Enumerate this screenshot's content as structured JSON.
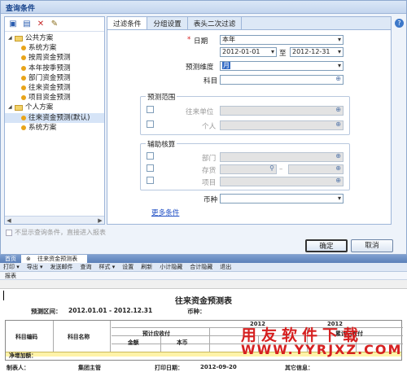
{
  "dialog": {
    "title": "查询条件"
  },
  "left_toolbar": {
    "icons": [
      "save-icon",
      "save-as-icon",
      "delete-icon",
      "edit-icon"
    ]
  },
  "tree": {
    "public": {
      "label": "公共方案",
      "items": [
        "系统方案",
        "按周资金预测",
        "本年按季预测",
        "部门资金预测",
        "往来资金预测",
        "项目资金预测"
      ]
    },
    "personal": {
      "label": "个人方案",
      "items": [
        "往来资金预测(默认)",
        "系统方案"
      ]
    }
  },
  "tabs": [
    "过滤条件",
    "分组设置",
    "表头二次过滤"
  ],
  "filter": {
    "date_label": "日期",
    "required_mark": "*",
    "date_value": "本年",
    "date_from": "2012-01-01",
    "date_to_label": "至",
    "date_to": "2012-12-31",
    "dimension_label": "预测维度",
    "dimension_value": "月",
    "subject_label": "科目",
    "scope_group": "预测范围",
    "unit_label": "往来单位",
    "person_label": "个人",
    "aux_group": "辅助核算",
    "dept_label": "部门",
    "stock_label": "存货",
    "range_sep": "–",
    "project_label": "项目",
    "currency_label": "币种",
    "more_link": "更多条件"
  },
  "footer": {
    "skip_text": "不显示查询条件，直接进入报表",
    "ok": "确定",
    "cancel": "取消"
  },
  "workspace_tabs": [
    "首页",
    "往来资金预测表"
  ],
  "toolbar": [
    "打印 ▾",
    "导出 ▾",
    "发送邮件",
    "查询",
    "样式 ▾",
    "设置",
    "刷新",
    "小计隐藏",
    "合计隐藏",
    "退出"
  ],
  "sub_tab": "报表",
  "report": {
    "title": "往来资金预测表",
    "range_label": "预测区间：",
    "range_value": "2012.01.01 - 2012.12.31",
    "currency_label": "币种：",
    "col_code": "科目编码",
    "col_name": "科目名称",
    "col_receivable": "预计应收付",
    "col_amount": "金额",
    "col_local": "本币",
    "col_year1": "2012",
    "col_year2": "2012",
    "col_received": "累计已收付",
    "net_inflow": "净增加额：",
    "maker_label": "制表人：",
    "maker_value": "集团主管",
    "print_date_label": "打印日期：",
    "print_date_value": "2012-09-20",
    "other_label": "其它信息："
  },
  "watermark": {
    "line1": "用友软件下载",
    "line2": "WWW.YYRJXZ.COM"
  }
}
